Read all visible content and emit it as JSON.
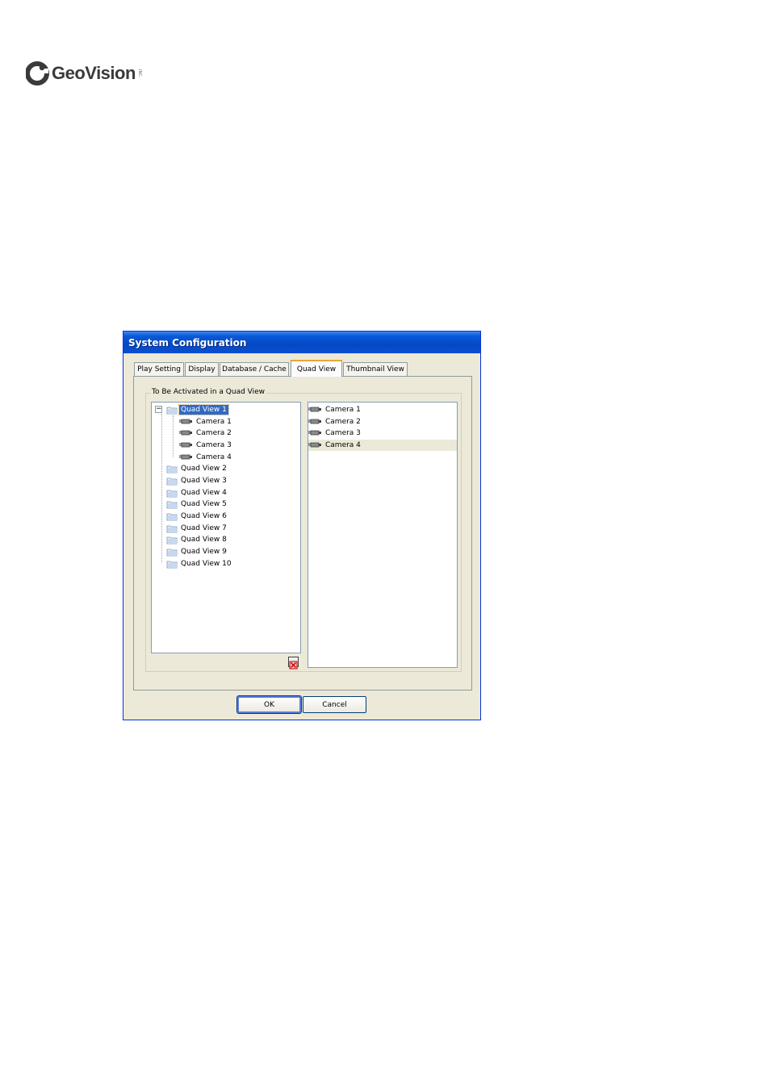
{
  "logo": {
    "text": "GeoVision",
    "tm": "INC."
  },
  "dialog": {
    "title": "System Configuration",
    "tabs": [
      "Play Setting",
      "Display",
      "Database / Cache",
      "Quad View",
      "Thumbnail View"
    ],
    "active_tab": "Quad View",
    "group_label": "To Be Activated in a Quad View",
    "tree": {
      "expanded": {
        "label": "Quad View 1",
        "children": [
          "Camera 1",
          "Camera 2",
          "Camera 3",
          "Camera 4"
        ]
      },
      "collapsed": [
        "Quad View 2",
        "Quad View 3",
        "Quad View 4",
        "Quad View 5",
        "Quad View 6",
        "Quad View 7",
        "Quad View 8",
        "Quad View 9",
        "Quad View 10"
      ]
    },
    "camera_list": [
      "Camera 1",
      "Camera 2",
      "Camera 3",
      "Camera 4"
    ],
    "ok_label": "OK",
    "cancel_label": "Cancel"
  },
  "colors": {
    "title_bar": "#0548c4",
    "selection": "#316ac5",
    "dialog_bg": "#ece9d8"
  }
}
